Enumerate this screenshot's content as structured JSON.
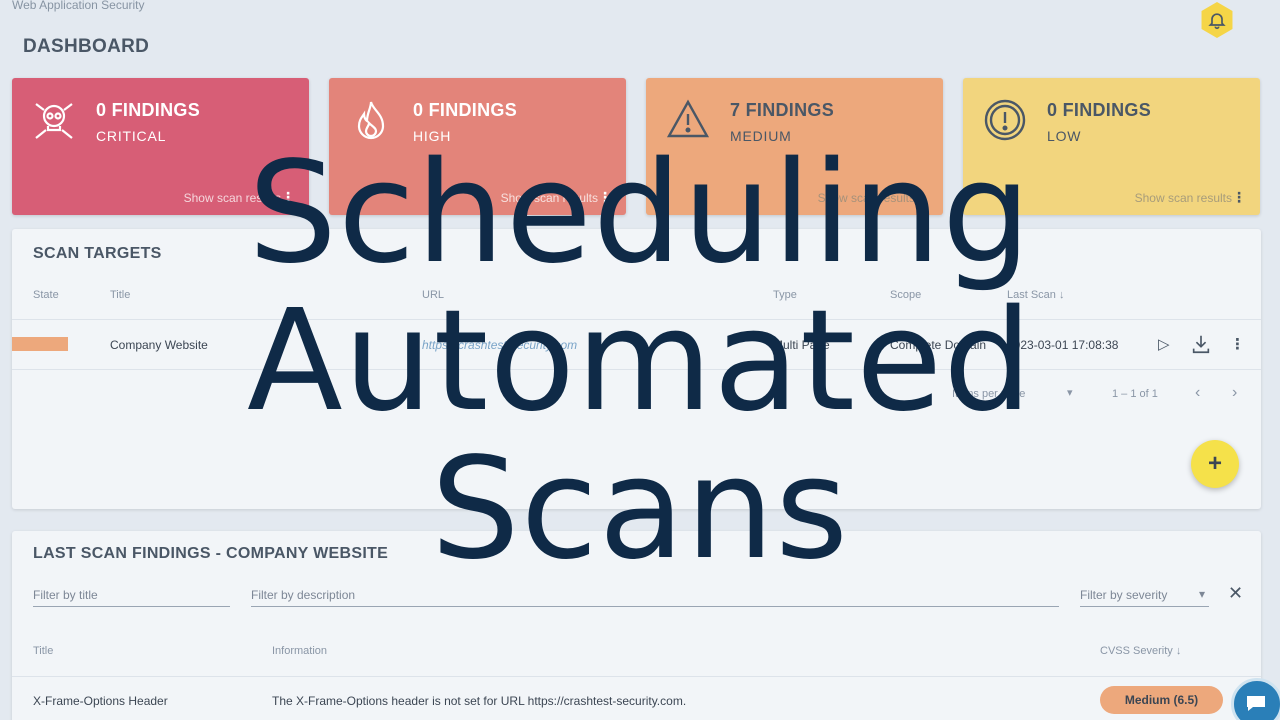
{
  "app": {
    "title": "Web Application Security",
    "page_title": "DASHBOARD"
  },
  "notification_icon": "bell-icon",
  "cards": [
    {
      "count": "0 FINDINGS",
      "level": "CRITICAL",
      "link": "Show scan results",
      "icon": "skull-icon",
      "color": "#d75e76"
    },
    {
      "count": "0 FINDINGS",
      "level": "HIGH",
      "link": "Show scan results",
      "icon": "flame-icon",
      "color": "#e3847a"
    },
    {
      "count": "7 FINDINGS",
      "level": "MEDIUM",
      "link": "Show scan results",
      "icon": "warning-icon",
      "color": "#eda87c"
    },
    {
      "count": "0 FINDINGS",
      "level": "LOW",
      "link": "Show scan results",
      "icon": "exclamation-circle-icon",
      "color": "#f2d57e"
    }
  ],
  "scan_targets": {
    "title": "SCAN TARGETS",
    "columns": [
      "State",
      "Title",
      "URL",
      "Type",
      "Scope",
      "Last Scan"
    ],
    "rows": [
      {
        "title": "Company Website",
        "url": "https://crashtest-security.com",
        "type": "Multi Page",
        "scope": "Complete Domain",
        "last_scan": "2023-03-01 17:08:38"
      }
    ],
    "pager": {
      "items_label": "Items per page",
      "range": "1 – 1 of 1"
    }
  },
  "findings": {
    "title": "LAST SCAN FINDINGS - COMPANY WEBSITE",
    "filters": {
      "title": "Filter by title",
      "description": "Filter by description",
      "severity": "Filter by severity"
    },
    "columns": [
      "Title",
      "Information",
      "CVSS Severity"
    ],
    "rows": [
      {
        "title": "X-Frame-Options Header",
        "information": "The X-Frame-Options header is not set for URL https://crashtest-security.com.",
        "severity": "Medium (6.5)"
      }
    ]
  },
  "overlay": {
    "lines": [
      "Scheduling",
      "Automated",
      "Scans"
    ]
  }
}
